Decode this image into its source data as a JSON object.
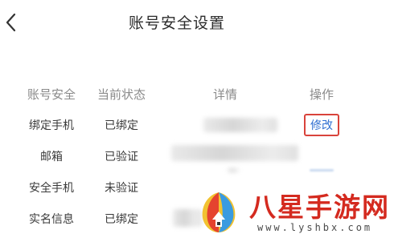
{
  "header": {
    "title": "账号安全设置",
    "back_icon": "chevron-left-icon"
  },
  "table": {
    "columns": [
      "账号安全",
      "当前状态",
      "详情",
      "操作"
    ],
    "rows": [
      {
        "item": "绑定手机",
        "status": "已绑定",
        "detail_blurred": true,
        "action": "修改",
        "action_highlighted": true
      },
      {
        "item": "邮箱",
        "status": "已验证",
        "detail_blurred": true,
        "action": ""
      },
      {
        "item": "安全手机",
        "status": "未验证",
        "detail_blurred": true,
        "action": ""
      },
      {
        "item": "实名信息",
        "status": "已绑定",
        "detail_blurred": true,
        "action": ""
      }
    ]
  },
  "colors": {
    "link": "#2f6fd1",
    "highlight_border": "#d9433b",
    "watermark_red": "#d42a1f"
  },
  "watermark": {
    "title": "八星手游网",
    "url": "www.lyshbx.com"
  }
}
